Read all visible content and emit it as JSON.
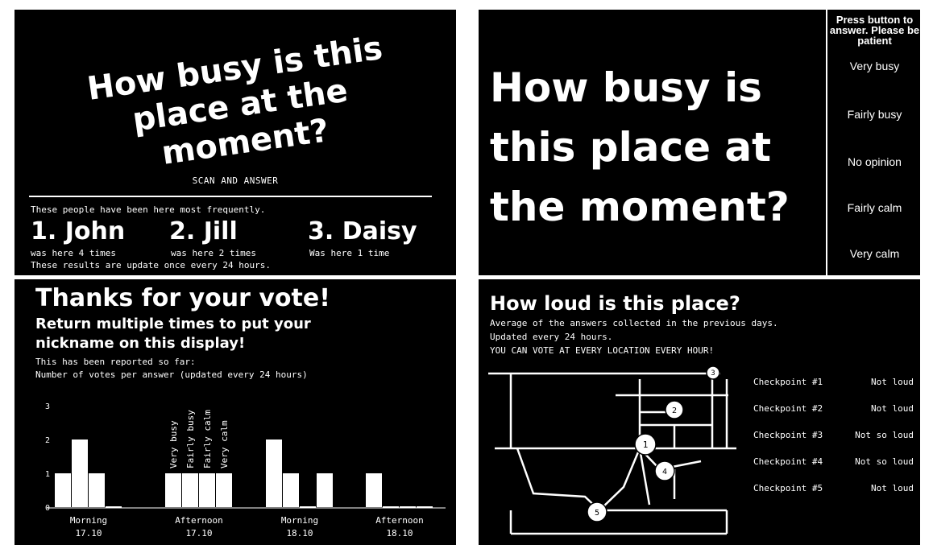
{
  "panel1": {
    "question": "How busy is this place at the moment?",
    "scan_label": "SCAN AND ANSWER",
    "intro": "These people have been here most frequently.",
    "leaders": [
      {
        "name": "1. John",
        "times": "was here 4 times"
      },
      {
        "name": "2. Jill",
        "times": "was here 2 times"
      },
      {
        "name": "3. Daisy",
        "times": "Was here 1 time"
      }
    ],
    "update_note": "These results are update once every 24 hours."
  },
  "panel2": {
    "question": "How busy is this place at the moment?",
    "instruction": "Press button to answer. Please be patient",
    "options": [
      "Very busy",
      "Fairly busy",
      "No opinion",
      "Fairly calm",
      "Very calm"
    ]
  },
  "panel3": {
    "title": "Thanks for your vote!",
    "subtitle": "Return multiple times to put your nickname on this display!",
    "reported": "This has been reported so far:",
    "votes_label": "Number of votes per answer (updated every 24 hours)"
  },
  "chart_data": {
    "type": "bar",
    "ylim": [
      0,
      3
    ],
    "yticks": [
      "0",
      "1",
      "2",
      "3"
    ],
    "groups": [
      {
        "label": "Morning",
        "date": "17.10",
        "values": [
          1,
          2,
          1,
          0
        ]
      },
      {
        "label": "Afternoon",
        "date": "17.10",
        "values": [
          1,
          1,
          1,
          1
        ]
      },
      {
        "label": "Morning",
        "date": "18.10",
        "values": [
          2,
          1,
          0,
          1
        ]
      },
      {
        "label": "Afternoon",
        "date": "18.10",
        "values": [
          1,
          0,
          0,
          0
        ]
      }
    ],
    "bar_labels": [
      "Very busy",
      "Fairly busy",
      "Fairly calm",
      "Very calm"
    ]
  },
  "panel4": {
    "title": "How loud is this place?",
    "line1": "Average of the answers collected in the previous days.",
    "line2": "Updated every 24 hours.",
    "line3": "YOU CAN VOTE AT EVERY LOCATION EVERY HOUR!",
    "markers": [
      "1",
      "2",
      "3",
      "4",
      "5"
    ],
    "checkpoints": [
      {
        "name": "Checkpoint #1",
        "value": "Not loud"
      },
      {
        "name": "Checkpoint #2",
        "value": "Not loud"
      },
      {
        "name": "Checkpoint #3",
        "value": "Not so loud"
      },
      {
        "name": "Checkpoint #4",
        "value": "Not so loud"
      },
      {
        "name": "Checkpoint #5",
        "value": "Not loud"
      }
    ]
  }
}
